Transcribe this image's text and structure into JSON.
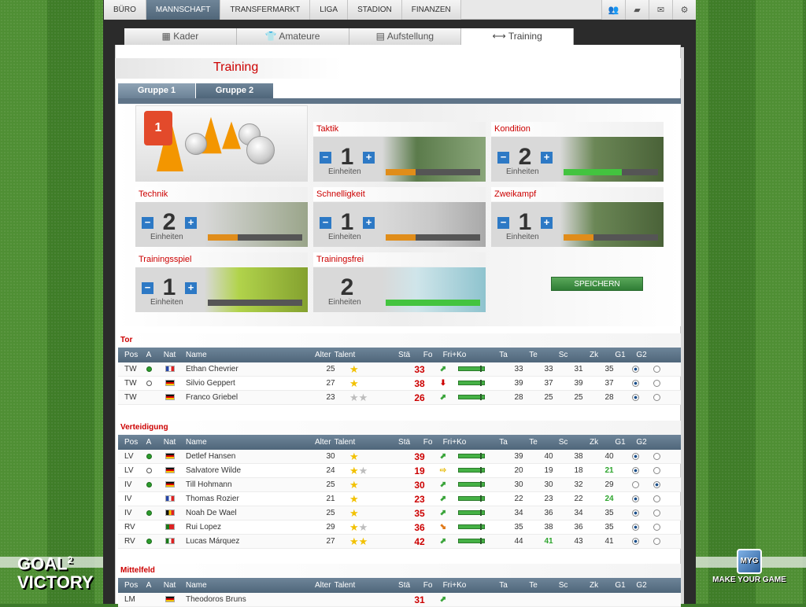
{
  "topnav": {
    "items": [
      "BÜRO",
      "MANNSCHAFT",
      "TRANSFERMARKT",
      "LIGA",
      "STADION",
      "FINANZEN"
    ],
    "active": 1,
    "icons": [
      "team-icon",
      "chat-icon",
      "mail-icon",
      "settings-icon"
    ]
  },
  "subtabs": [
    {
      "label": "Kader",
      "icon": "lineup-icon"
    },
    {
      "label": "Amateure",
      "icon": "shirt-icon"
    },
    {
      "label": "Aufstellung",
      "icon": "clipboard-icon"
    },
    {
      "label": "Training",
      "icon": "dumbbell-icon"
    }
  ],
  "page_title": "Training",
  "group_tabs": [
    "Gruppe 1",
    "Gruppe 2"
  ],
  "units_label": "Einheiten",
  "hero_shirt": "1",
  "training": [
    {
      "label": "Taktik",
      "units": "1",
      "progress": 0.32,
      "bar": "orange"
    },
    {
      "label": "Kondition",
      "units": "2",
      "progress": 0.62,
      "bar": "green"
    },
    {
      "label": "Technik",
      "units": "2",
      "progress": 0.32,
      "bar": "orange"
    },
    {
      "label": "Schnelligkeit",
      "units": "1",
      "progress": 0.32,
      "bar": "orange"
    },
    {
      "label": "Zweikampf",
      "units": "1",
      "progress": 0.32,
      "bar": "orange"
    },
    {
      "label": "Trainingsspiel",
      "units": "1",
      "progress": 0,
      "bar": "orange"
    },
    {
      "label": "Trainingsfrei",
      "units": "2",
      "progress": 1,
      "bar": "green"
    }
  ],
  "save_label": "SPEICHERN",
  "columns": [
    "Pos",
    "A",
    "Nat",
    "Name",
    "Alter",
    "Talent",
    "Stä",
    "Fo",
    "Fri+Ko",
    "Ta",
    "Te",
    "Sc",
    "Zk",
    "G1",
    "G2"
  ],
  "sections": [
    {
      "title": "Tor",
      "rows": [
        {
          "pos": "TW",
          "a": "on",
          "nat": "fr",
          "name": "Ethan Chevrier",
          "alter": "25",
          "talent": [
            1,
            0
          ],
          "sta": "33",
          "fo": "up",
          "ta": "33",
          "te": "33",
          "sc": "31",
          "zk": "35",
          "g": 1
        },
        {
          "pos": "TW",
          "a": "off",
          "nat": "de",
          "name": "Silvio Geppert",
          "alter": "27",
          "talent": [
            1,
            0
          ],
          "sta": "38",
          "fo": "dn",
          "ta": "39",
          "te": "37",
          "sc": "39",
          "zk": "37",
          "g": 1
        },
        {
          "pos": "TW",
          "a": "",
          "nat": "de",
          "name": "Franco Griebel",
          "alter": "23",
          "talent": [
            0,
            2
          ],
          "sta": "26",
          "fo": "up",
          "ta": "28",
          "te": "25",
          "sc": "25",
          "zk": "28",
          "g": 1
        }
      ]
    },
    {
      "title": "Verteidigung",
      "rows": [
        {
          "pos": "LV",
          "a": "on",
          "nat": "de",
          "name": "Detlef Hansen",
          "alter": "30",
          "talent": [
            1,
            0
          ],
          "sta": "39",
          "fo": "up",
          "ta": "39",
          "te": "40",
          "sc": "38",
          "zk": "40",
          "g": 1
        },
        {
          "pos": "LV",
          "a": "off",
          "nat": "de",
          "name": "Salvatore Wilde",
          "alter": "24",
          "talent": [
            1,
            1
          ],
          "sta": "19",
          "fo": "rt",
          "ta": "20",
          "te": "19",
          "sc": "18",
          "zk": "21",
          "zkg": true,
          "g": 1
        },
        {
          "pos": "IV",
          "a": "on",
          "nat": "de",
          "name": "Till Hohmann",
          "alter": "25",
          "talent": [
            1,
            0
          ],
          "sta": "30",
          "fo": "up",
          "ta": "30",
          "te": "30",
          "sc": "32",
          "zk": "29",
          "g": 2
        },
        {
          "pos": "IV",
          "a": "",
          "nat": "fr",
          "name": "Thomas Rozier",
          "alter": "21",
          "talent": [
            1,
            0
          ],
          "sta": "23",
          "fo": "up",
          "ta": "22",
          "te": "23",
          "sc": "22",
          "zk": "24",
          "zkg": true,
          "g": 1
        },
        {
          "pos": "IV",
          "a": "on",
          "nat": "be",
          "name": "Noah De Wael",
          "alter": "25",
          "talent": [
            1,
            0
          ],
          "sta": "35",
          "fo": "up",
          "ta": "34",
          "te": "36",
          "sc": "34",
          "zk": "35",
          "g": 1
        },
        {
          "pos": "RV",
          "a": "",
          "nat": "pt",
          "name": "Rui Lopez",
          "alter": "29",
          "talent": [
            1,
            1
          ],
          "sta": "36",
          "fo": "dr",
          "ta": "35",
          "te": "38",
          "sc": "36",
          "zk": "35",
          "g": 1
        },
        {
          "pos": "RV",
          "a": "on",
          "nat": "mx",
          "name": "Lucas Márquez",
          "alter": "27",
          "talent": [
            2,
            0
          ],
          "sta": "42",
          "fo": "up",
          "ta": "44",
          "te": "41",
          "teg": true,
          "sc": "43",
          "zk": "41",
          "g": 1
        }
      ]
    },
    {
      "title": "Mittelfeld",
      "rows": [
        {
          "pos": "LM",
          "a": "",
          "nat": "de",
          "name": "Theodoros Bruns",
          "alter": "",
          "talent": [
            0,
            0
          ],
          "sta": "31",
          "fo": "up",
          "ta": "",
          "te": "",
          "sc": "",
          "zk": "",
          "g": 0
        }
      ]
    }
  ],
  "brand_left": {
    "line1": "GOAL",
    "sup": "2",
    "line2": "VICTORY"
  },
  "brand_right": {
    "badge": "MYG",
    "text": "MAKE YOUR GAME"
  }
}
